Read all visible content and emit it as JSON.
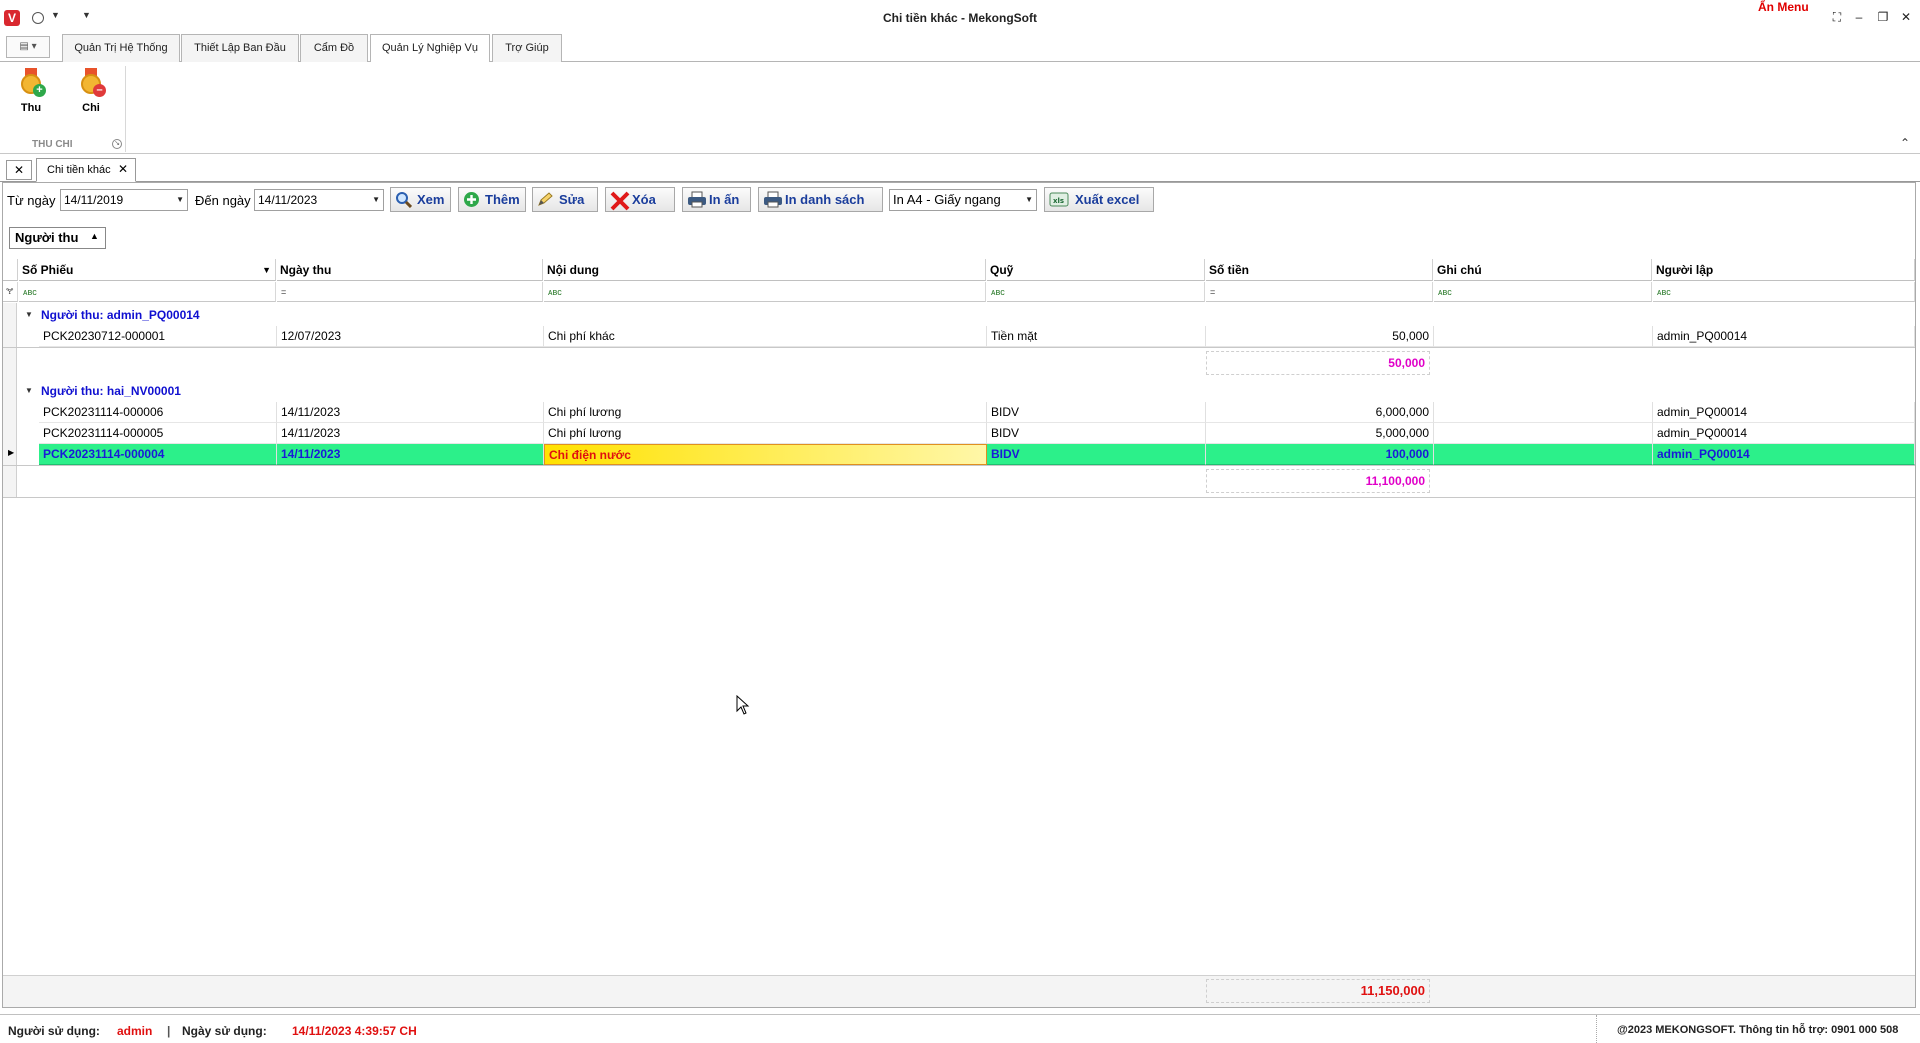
{
  "window": {
    "title": "Chi tiền khác - MekongSoft",
    "hide_menu": "Ẩn Menu",
    "app_logo_letter": "V"
  },
  "ribbon": {
    "tabs": [
      "Quản Trị Hệ Thống",
      "Thiết Lập Ban Đầu",
      "Cẩm Đồ",
      "Quản Lý Nghiệp Vụ",
      "Trợ Giúp"
    ],
    "active_tab": "Quản Lý Nghiệp Vụ",
    "group_label": "THU CHI",
    "buttons": [
      {
        "label": "Thu",
        "icon": "medal-plus-icon"
      },
      {
        "label": "Chi",
        "icon": "medal-minus-icon"
      }
    ]
  },
  "doc_tab": {
    "label": "Chi tiền khác"
  },
  "toolbar": {
    "from_label": "Từ ngày",
    "from_value": "14/11/2019",
    "to_label": "Đến ngày",
    "to_value": "14/11/2023",
    "view": "Xem",
    "add": "Thêm",
    "edit": "Sửa",
    "delete": "Xóa",
    "print": "In ấn",
    "print_list": "In danh sách",
    "paper_select": "In A4 - Giấy ngang",
    "export": "Xuất excel"
  },
  "group_panel": {
    "chip": "Người thu"
  },
  "grid": {
    "columns": [
      "Số Phiếu",
      "Ngày thu",
      "Nội dung",
      "Quỹ",
      "Số tiền",
      "Ghi chú",
      "Người lập"
    ],
    "groups": [
      {
        "header": "Người thu: admin_PQ00014",
        "rows": [
          [
            "PCK20230712-000001",
            "12/07/2023",
            "Chi phí khác",
            "Tiền mặt",
            "50,000",
            "",
            "admin_PQ00014"
          ]
        ],
        "total": "50,000"
      },
      {
        "header": "Người thu: hai_NV00001",
        "rows": [
          [
            "PCK20231114-000006",
            "14/11/2023",
            "Chi phí lương",
            "BIDV",
            "6,000,000",
            "",
            "admin_PQ00014"
          ],
          [
            "PCK20231114-000005",
            "14/11/2023",
            "Chi phí lương",
            "BIDV",
            "5,000,000",
            "",
            "admin_PQ00014"
          ],
          [
            "PCK20231114-000004",
            "14/11/2023",
            "Chi điện nước",
            "BIDV",
            "100,000",
            "",
            "admin_PQ00014"
          ]
        ],
        "total": "11,100,000"
      }
    ],
    "grand_total": "11,150,000"
  },
  "status": {
    "user_label": "Người sử dụng:",
    "user_value": "admin",
    "date_label": "Ngày sử dụng:",
    "date_value": "14/11/2023 4:39:57 CH",
    "copyright": "@2023 MEKONGSOFT. Thông tin hỗ trợ: 0901 000 508"
  },
  "colors": {
    "selected_row": "#2cf08a",
    "group_text": "#1010d0",
    "subtotal": "#e000c8",
    "grand_total": "#e01010",
    "toolbar_text": "#1a3d9c"
  }
}
